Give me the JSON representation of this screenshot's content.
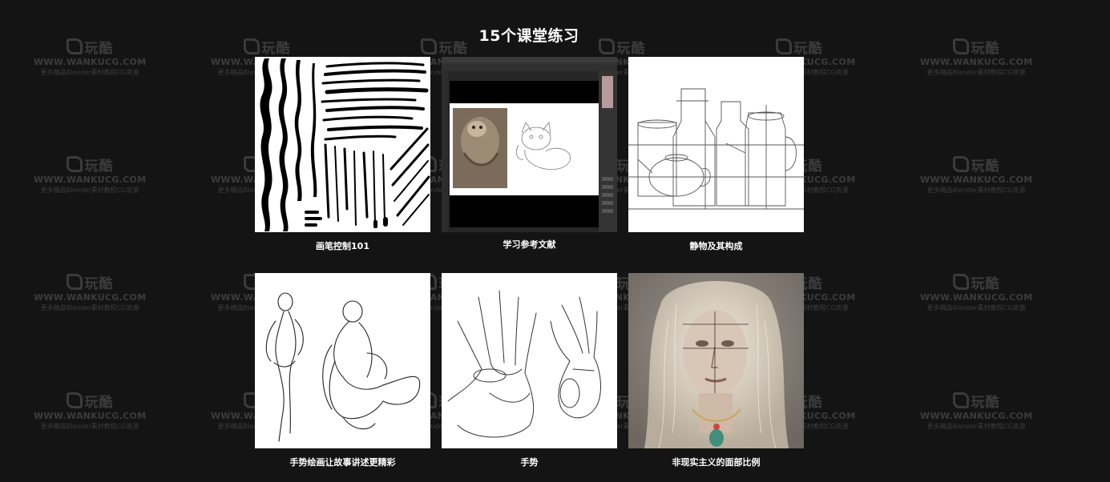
{
  "section": {
    "title": "15个课堂练习"
  },
  "watermark": {
    "logo": "玩酷",
    "site": "WWW.WANKUCG.COM",
    "tagline": "更多精品Blender素材教程CG资源"
  },
  "lessons": [
    {
      "caption": "画笔控制101",
      "image": "brush-strokes-image"
    },
    {
      "caption": "学习参考文献",
      "image": "photoshop-reference-image"
    },
    {
      "caption": "静物及其构成",
      "image": "still-life-sketch-image"
    },
    {
      "caption": "手势绘画让故事讲述更精彩",
      "image": "gesture-figure-image"
    },
    {
      "caption": "手势",
      "image": "hand-sketch-image"
    },
    {
      "caption": "非现实主义的面部比例",
      "image": "portrait-painting-image"
    }
  ]
}
